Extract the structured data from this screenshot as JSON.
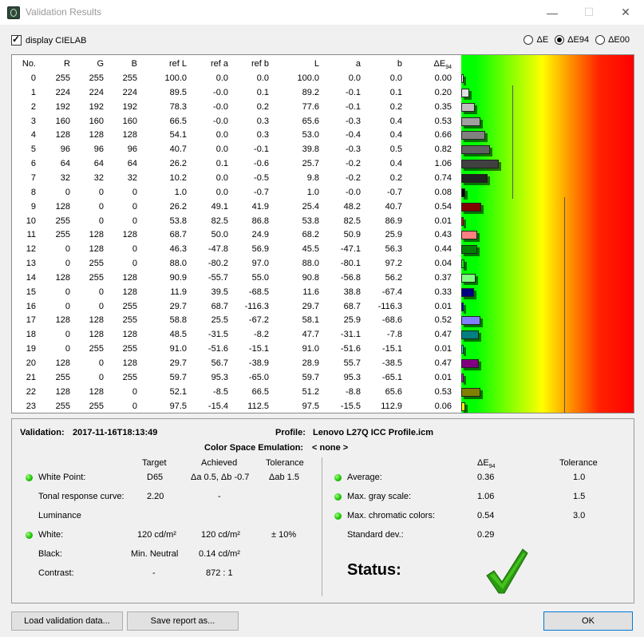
{
  "window": {
    "title": "Validation Results",
    "minimize": "—",
    "maximize": "☐",
    "close": "✕"
  },
  "options": {
    "cielab_label": "display CIELAB",
    "cielab_checked": true,
    "radios": [
      {
        "label": "ΔE",
        "selected": false
      },
      {
        "label": "ΔE94",
        "selected": true
      },
      {
        "label": "ΔE00",
        "selected": false
      }
    ]
  },
  "table": {
    "headers": [
      "No.",
      "R",
      "G",
      "B",
      "ref L",
      "ref a",
      "ref b",
      "L",
      "a",
      "b",
      "ΔE"
    ],
    "de_sub": "94",
    "rows": [
      [
        "0",
        "255",
        "255",
        "255",
        "100.0",
        "0.0",
        "0.0",
        "100.0",
        "0.0",
        "0.0",
        "0.00"
      ],
      [
        "1",
        "224",
        "224",
        "224",
        "89.5",
        "-0.0",
        "0.1",
        "89.2",
        "-0.1",
        "0.1",
        "0.20"
      ],
      [
        "2",
        "192",
        "192",
        "192",
        "78.3",
        "-0.0",
        "0.2",
        "77.6",
        "-0.1",
        "0.2",
        "0.35"
      ],
      [
        "3",
        "160",
        "160",
        "160",
        "66.5",
        "-0.0",
        "0.3",
        "65.6",
        "-0.3",
        "0.4",
        "0.53"
      ],
      [
        "4",
        "128",
        "128",
        "128",
        "54.1",
        "0.0",
        "0.3",
        "53.0",
        "-0.4",
        "0.4",
        "0.66"
      ],
      [
        "5",
        "96",
        "96",
        "96",
        "40.7",
        "0.0",
        "-0.1",
        "39.8",
        "-0.3",
        "0.5",
        "0.82"
      ],
      [
        "6",
        "64",
        "64",
        "64",
        "26.2",
        "0.1",
        "-0.6",
        "25.7",
        "-0.2",
        "0.4",
        "1.06"
      ],
      [
        "7",
        "32",
        "32",
        "32",
        "10.2",
        "0.0",
        "-0.5",
        "9.8",
        "-0.2",
        "0.2",
        "0.74"
      ],
      [
        "8",
        "0",
        "0",
        "0",
        "1.0",
        "0.0",
        "-0.7",
        "1.0",
        "-0.0",
        "-0.7",
        "0.08"
      ],
      [
        "9",
        "128",
        "0",
        "0",
        "26.2",
        "49.1",
        "41.9",
        "25.4",
        "48.2",
        "40.7",
        "0.54"
      ],
      [
        "10",
        "255",
        "0",
        "0",
        "53.8",
        "82.5",
        "86.8",
        "53.8",
        "82.5",
        "86.9",
        "0.01"
      ],
      [
        "11",
        "255",
        "128",
        "128",
        "68.7",
        "50.0",
        "24.9",
        "68.2",
        "50.9",
        "25.9",
        "0.43"
      ],
      [
        "12",
        "0",
        "128",
        "0",
        "46.3",
        "-47.8",
        "56.9",
        "45.5",
        "-47.1",
        "56.3",
        "0.44"
      ],
      [
        "13",
        "0",
        "255",
        "0",
        "88.0",
        "-80.2",
        "97.0",
        "88.0",
        "-80.1",
        "97.2",
        "0.04"
      ],
      [
        "14",
        "128",
        "255",
        "128",
        "90.9",
        "-55.7",
        "55.0",
        "90.8",
        "-56.8",
        "56.2",
        "0.37"
      ],
      [
        "15",
        "0",
        "0",
        "128",
        "11.9",
        "39.5",
        "-68.5",
        "11.6",
        "38.8",
        "-67.4",
        "0.33"
      ],
      [
        "16",
        "0",
        "0",
        "255",
        "29.7",
        "68.7",
        "-116.3",
        "29.7",
        "68.7",
        "-116.3",
        "0.01"
      ],
      [
        "17",
        "128",
        "128",
        "255",
        "58.8",
        "25.5",
        "-67.2",
        "58.1",
        "25.9",
        "-68.6",
        "0.52"
      ],
      [
        "18",
        "0",
        "128",
        "128",
        "48.5",
        "-31.5",
        "-8.2",
        "47.7",
        "-31.1",
        "-7.8",
        "0.47"
      ],
      [
        "19",
        "0",
        "255",
        "255",
        "91.0",
        "-51.6",
        "-15.1",
        "91.0",
        "-51.6",
        "-15.1",
        "0.01"
      ],
      [
        "20",
        "128",
        "0",
        "128",
        "29.7",
        "56.7",
        "-38.9",
        "28.9",
        "55.7",
        "-38.5",
        "0.47"
      ],
      [
        "21",
        "255",
        "0",
        "255",
        "59.7",
        "95.3",
        "-65.0",
        "59.7",
        "95.3",
        "-65.1",
        "0.01"
      ],
      [
        "22",
        "128",
        "128",
        "0",
        "52.1",
        "-8.5",
        "66.5",
        "51.2",
        "-8.8",
        "65.6",
        "0.53"
      ],
      [
        "23",
        "255",
        "255",
        "0",
        "97.5",
        "-15.4",
        "112.5",
        "97.5",
        "-15.5",
        "112.9",
        "0.06"
      ]
    ]
  },
  "summary": {
    "validation_label": "Validation:",
    "validation_date": "2017-11-16T18:13:49",
    "profile_label": "Profile:",
    "profile_name": "Lenovo L27Q ICC Profile.icm",
    "emulation_label": "Color Space Emulation:",
    "emulation_value": "< none >",
    "col_target": "Target",
    "col_achieved": "Achieved",
    "col_tolerance": "Tolerance",
    "white_point": {
      "label": "White Point:",
      "target": "D65",
      "achieved": "Δa 0.5, Δb -0.7",
      "tolerance": "Δab 1.5"
    },
    "trc": {
      "label": "Tonal response curve:",
      "target": "2.20",
      "achieved": "-"
    },
    "luminance": "Luminance",
    "white": {
      "label": "White:",
      "target": "120 cd/m²",
      "achieved": "120 cd/m²",
      "tolerance": "± 10%"
    },
    "black": {
      "label": "Black:",
      "target": "Min. Neutral",
      "achieved": "0.14 cd/m²"
    },
    "contrast": {
      "label": "Contrast:",
      "target": "-",
      "achieved": "872 : 1"
    },
    "right_de": "ΔE",
    "right_de_sub": "94",
    "right_tol": "Tolerance",
    "average": {
      "label": "Average:",
      "value": "0.36",
      "tolerance": "1.0"
    },
    "gray": {
      "label": "Max. gray scale:",
      "value": "1.06",
      "tolerance": "1.5"
    },
    "chroma": {
      "label": "Max. chromatic colors:",
      "value": "0.54",
      "tolerance": "3.0"
    },
    "stddev": {
      "label": "Standard dev.:",
      "value": "0.29"
    },
    "status_label": "Status:"
  },
  "buttons": {
    "load": "Load validation data...",
    "save": "Save report as...",
    "ok": "OK"
  },
  "colors": {
    "pass": "#22a000",
    "gradient": [
      "#00ff00",
      "#ffff00",
      "#ff0000"
    ]
  }
}
